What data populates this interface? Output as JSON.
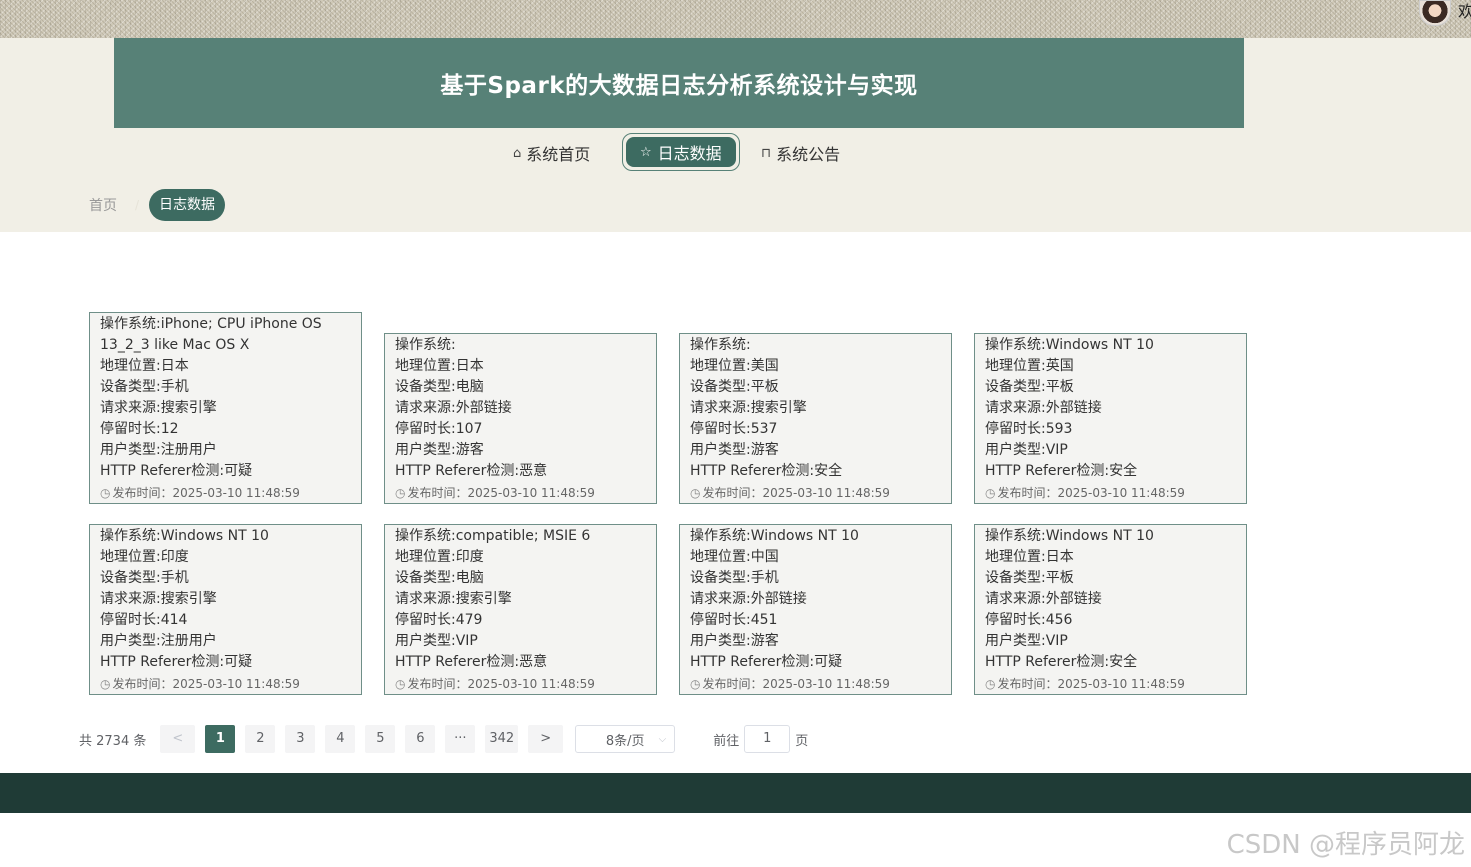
{
  "header": {
    "title": "基于Spark的大数据日志分析系统设计与实现",
    "welcome_fragment": "欢"
  },
  "nav": [
    {
      "icon": "home-icon",
      "glyph": "⌂",
      "label": "系统首页"
    },
    {
      "icon": "star-icon",
      "glyph": "☆",
      "label": "日志数据",
      "active": true
    },
    {
      "icon": "bag-icon",
      "glyph": "⊓",
      "label": "系统公告"
    }
  ],
  "breadcrumb": {
    "home": "首页",
    "separator": "/",
    "current": "日志数据"
  },
  "cards": [
    {
      "os": "操作系统:iPhone; CPU iPhone OS 13_2_3 like Mac OS X",
      "location": "地理位置:日本",
      "device": "设备类型:手机",
      "source": "请求来源:搜索引擎",
      "duration": "停留时长:12",
      "user_type": "用户类型:注册用户",
      "referer": "HTTP Referer检测:可疑",
      "time": "发布时间：2025-03-10 11:48:59"
    },
    {
      "os": "操作系统:",
      "location": "地理位置:日本",
      "device": "设备类型:电脑",
      "source": "请求来源:外部链接",
      "duration": "停留时长:107",
      "user_type": "用户类型:游客",
      "referer": "HTTP Referer检测:恶意",
      "time": "发布时间：2025-03-10 11:48:59"
    },
    {
      "os": "操作系统:",
      "location": "地理位置:美国",
      "device": "设备类型:平板",
      "source": "请求来源:搜索引擎",
      "duration": "停留时长:537",
      "user_type": "用户类型:游客",
      "referer": "HTTP Referer检测:安全",
      "time": "发布时间：2025-03-10 11:48:59"
    },
    {
      "os": "操作系统:Windows NT 10",
      "location": "地理位置:英国",
      "device": "设备类型:平板",
      "source": "请求来源:外部链接",
      "duration": "停留时长:593",
      "user_type": "用户类型:VIP",
      "referer": "HTTP Referer检测:安全",
      "time": "发布时间：2025-03-10 11:48:59"
    },
    {
      "os": "操作系统:Windows NT 10",
      "location": "地理位置:印度",
      "device": "设备类型:手机",
      "source": "请求来源:搜索引擎",
      "duration": "停留时长:414",
      "user_type": "用户类型:注册用户",
      "referer": "HTTP Referer检测:可疑",
      "time": "发布时间：2025-03-10 11:48:59"
    },
    {
      "os": "操作系统:compatible; MSIE 6",
      "location": "地理位置:印度",
      "device": "设备类型:电脑",
      "source": "请求来源:搜索引擎",
      "duration": "停留时长:479",
      "user_type": "用户类型:VIP",
      "referer": "HTTP Referer检测:恶意",
      "time": "发布时间：2025-03-10 11:48:59"
    },
    {
      "os": "操作系统:Windows NT 10",
      "location": "地理位置:中国",
      "device": "设备类型:手机",
      "source": "请求来源:外部链接",
      "duration": "停留时长:451",
      "user_type": "用户类型:游客",
      "referer": "HTTP Referer检测:可疑",
      "time": "发布时间：2025-03-10 11:48:59"
    },
    {
      "os": "操作系统:Windows NT 10",
      "location": "地理位置:日本",
      "device": "设备类型:平板",
      "source": "请求来源:外部链接",
      "duration": "停留时长:456",
      "user_type": "用户类型:VIP",
      "referer": "HTTP Referer检测:安全",
      "time": "发布时间：2025-03-10 11:48:59"
    }
  ],
  "pagination": {
    "total": "共 2734 条",
    "prev": "<",
    "pages": [
      "1",
      "2",
      "3",
      "4",
      "5",
      "6",
      "···",
      "342"
    ],
    "current_page": "1",
    "next": ">",
    "page_size": "8条/页",
    "goto_label": "前往",
    "goto_value": "1",
    "goto_suffix": "页"
  },
  "watermark": "CSDN @程序员阿龙",
  "colors": {
    "primary": "#578177",
    "primary_dark": "#3d6b61",
    "footer": "#1f3b36",
    "header_bg": "#f1efe6"
  }
}
